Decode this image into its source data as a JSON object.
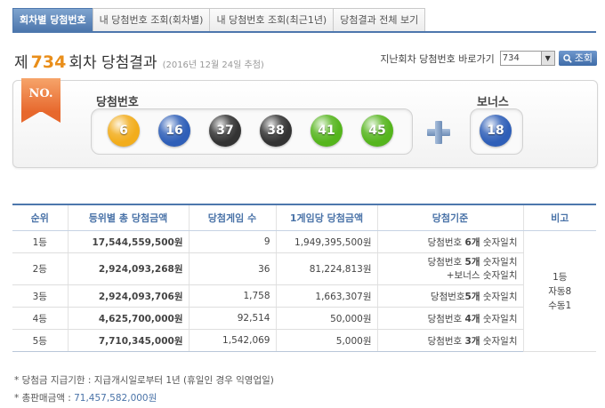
{
  "tabs": [
    {
      "label": "회차별 당첨번호",
      "active": true
    },
    {
      "label": "내 당첨번호 조회(회차별)",
      "active": false
    },
    {
      "label": "내 당첨번호 조회(최근1년)",
      "active": false
    },
    {
      "label": "당첨결과 전체 보기",
      "active": false
    }
  ],
  "header": {
    "prefix": "제",
    "round": "734",
    "suffix": "회차 당첨결과",
    "date": "(2016년 12월 24일 추첨)"
  },
  "goto": {
    "label": "지난회차 당첨번호 바로가기",
    "selected": "734",
    "button": "조회"
  },
  "draw": {
    "badge": "NO.",
    "numbers_label": "당첨번호",
    "bonus_label": "보너스",
    "numbers": [
      {
        "value": "6",
        "color": "#f2ad1c"
      },
      {
        "value": "16",
        "color": "#2f5fb8"
      },
      {
        "value": "37",
        "color": "#333333"
      },
      {
        "value": "38",
        "color": "#333333"
      },
      {
        "value": "41",
        "color": "#55b51d"
      },
      {
        "value": "45",
        "color": "#55b51d"
      }
    ],
    "bonus": {
      "value": "18",
      "color": "#2f5fb8"
    }
  },
  "table": {
    "headers": [
      "순위",
      "등위별 총 당첨금액",
      "당첨게임 수",
      "1게임당 당첨금액",
      "당첨기준",
      "비고"
    ],
    "rows": [
      {
        "rank": "1등",
        "total": "17,544,559,500원",
        "games": "9",
        "per_game": "1,949,395,500원",
        "criteria_pre": "당첨번호 ",
        "criteria_bold": "6개",
        "criteria_post": " 숫자일치",
        "criteria_line2": ""
      },
      {
        "rank": "2등",
        "total": "2,924,093,268원",
        "games": "36",
        "per_game": "81,224,813원",
        "criteria_pre": "당첨번호 ",
        "criteria_bold": "5개",
        "criteria_post": " 숫자일치",
        "criteria_line2": "+보너스 숫자일치"
      },
      {
        "rank": "3등",
        "total": "2,924,093,706원",
        "games": "1,758",
        "per_game": "1,663,307원",
        "criteria_pre": "당첨번호",
        "criteria_bold": "5개",
        "criteria_post": " 숫자일치",
        "criteria_line2": ""
      },
      {
        "rank": "4등",
        "total": "4,625,700,000원",
        "games": "92,514",
        "per_game": "50,000원",
        "criteria_pre": "당첨번호 ",
        "criteria_bold": "4개",
        "criteria_post": " 숫자일치",
        "criteria_line2": ""
      },
      {
        "rank": "5등",
        "total": "7,710,345,000원",
        "games": "1,542,069",
        "per_game": "5,000원",
        "criteria_pre": "당첨번호 ",
        "criteria_bold": "3개",
        "criteria_post": " 숫자일치",
        "criteria_line2": ""
      }
    ],
    "remark": [
      "1등",
      "자동8",
      "수동1"
    ]
  },
  "notes": {
    "deadline": "* 당첨금 지급기한 : 지급개시일로부터 1년 (휴일인 경우 익영업일)",
    "sales_label": "* 총판매금액 : ",
    "sales_value": "71,457,582,000원"
  }
}
